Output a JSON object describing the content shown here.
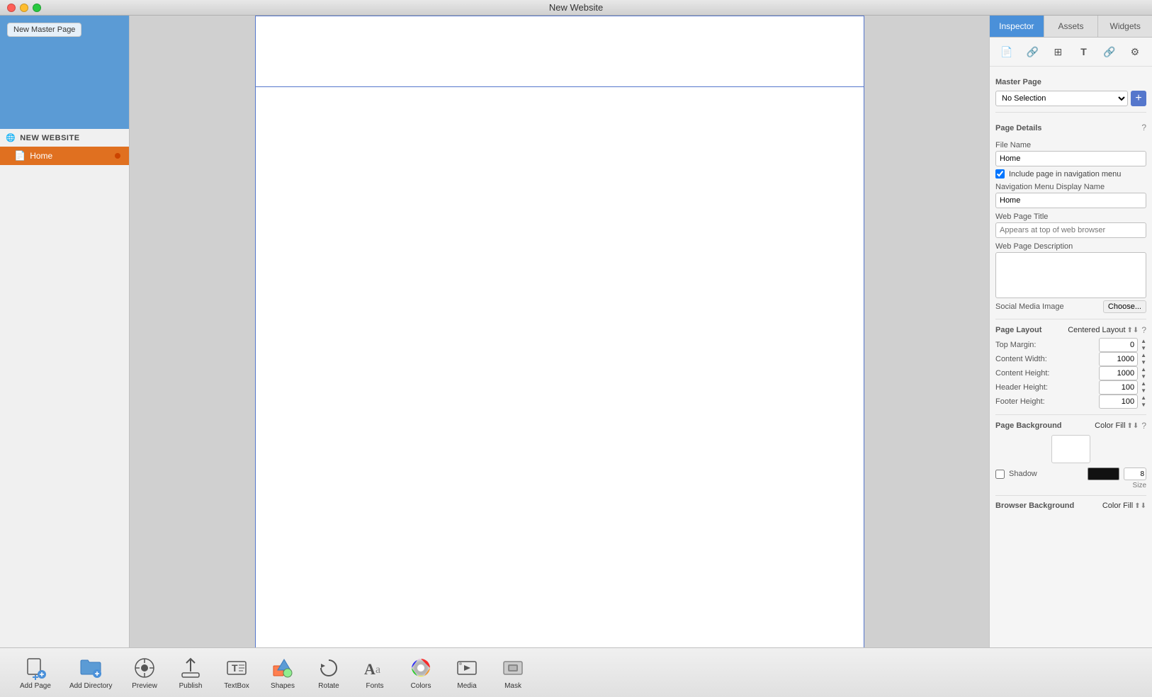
{
  "titlebar": {
    "title": "New Website"
  },
  "sidebar": {
    "new_master_page_label": "New Master Page",
    "site_label": "NEW WEBSITE",
    "pages": [
      {
        "label": "Home",
        "active": true
      }
    ]
  },
  "inspector": {
    "tabs": [
      {
        "label": "Inspector",
        "active": true
      },
      {
        "label": "Assets",
        "active": false
      },
      {
        "label": "Widgets",
        "active": false
      }
    ],
    "master_page": {
      "label": "Master Page",
      "dropdown_value": "No Selection"
    },
    "page_details": {
      "label": "Page Details",
      "file_name_label": "File Name",
      "file_name_value": "Home",
      "include_nav_label": "Include page in navigation menu",
      "include_nav_checked": true,
      "nav_display_label": "Navigation Menu Display Name",
      "nav_display_value": "Home",
      "web_title_label": "Web Page Title",
      "web_title_placeholder": "Appears at top of web browser",
      "web_desc_label": "Web Page Description",
      "social_media_label": "Social Media Image",
      "social_media_btn": "Choose..."
    },
    "page_layout": {
      "label": "Page Layout",
      "layout_value": "Centered Layout",
      "top_margin_label": "Top Margin:",
      "top_margin_value": "0",
      "content_width_label": "Content Width:",
      "content_width_value": "1000",
      "content_height_label": "Content Height:",
      "content_height_value": "1000",
      "header_height_label": "Header Height:",
      "header_height_value": "100",
      "footer_height_label": "Footer Height:",
      "footer_height_value": "100"
    },
    "page_background": {
      "label": "Page Background",
      "fill_value": "Color Fill",
      "shadow_label": "Shadow",
      "shadow_checked": false,
      "size_label": "Size",
      "size_value": "8"
    },
    "browser_background": {
      "label": "Browser Background",
      "fill_value": "Color Fill"
    }
  },
  "toolbar": {
    "items": [
      {
        "label": "Add Page",
        "icon": "add-page"
      },
      {
        "label": "Add Directory",
        "icon": "add-directory"
      },
      {
        "label": "Preview",
        "icon": "preview"
      },
      {
        "label": "Publish",
        "icon": "publish"
      },
      {
        "label": "TextBox",
        "icon": "textbox"
      },
      {
        "label": "Shapes",
        "icon": "shapes"
      },
      {
        "label": "Rotate",
        "icon": "rotate"
      },
      {
        "label": "Fonts",
        "icon": "fonts"
      },
      {
        "label": "Colors",
        "icon": "colors"
      },
      {
        "label": "Media",
        "icon": "media"
      },
      {
        "label": "Mask",
        "icon": "mask"
      }
    ]
  }
}
